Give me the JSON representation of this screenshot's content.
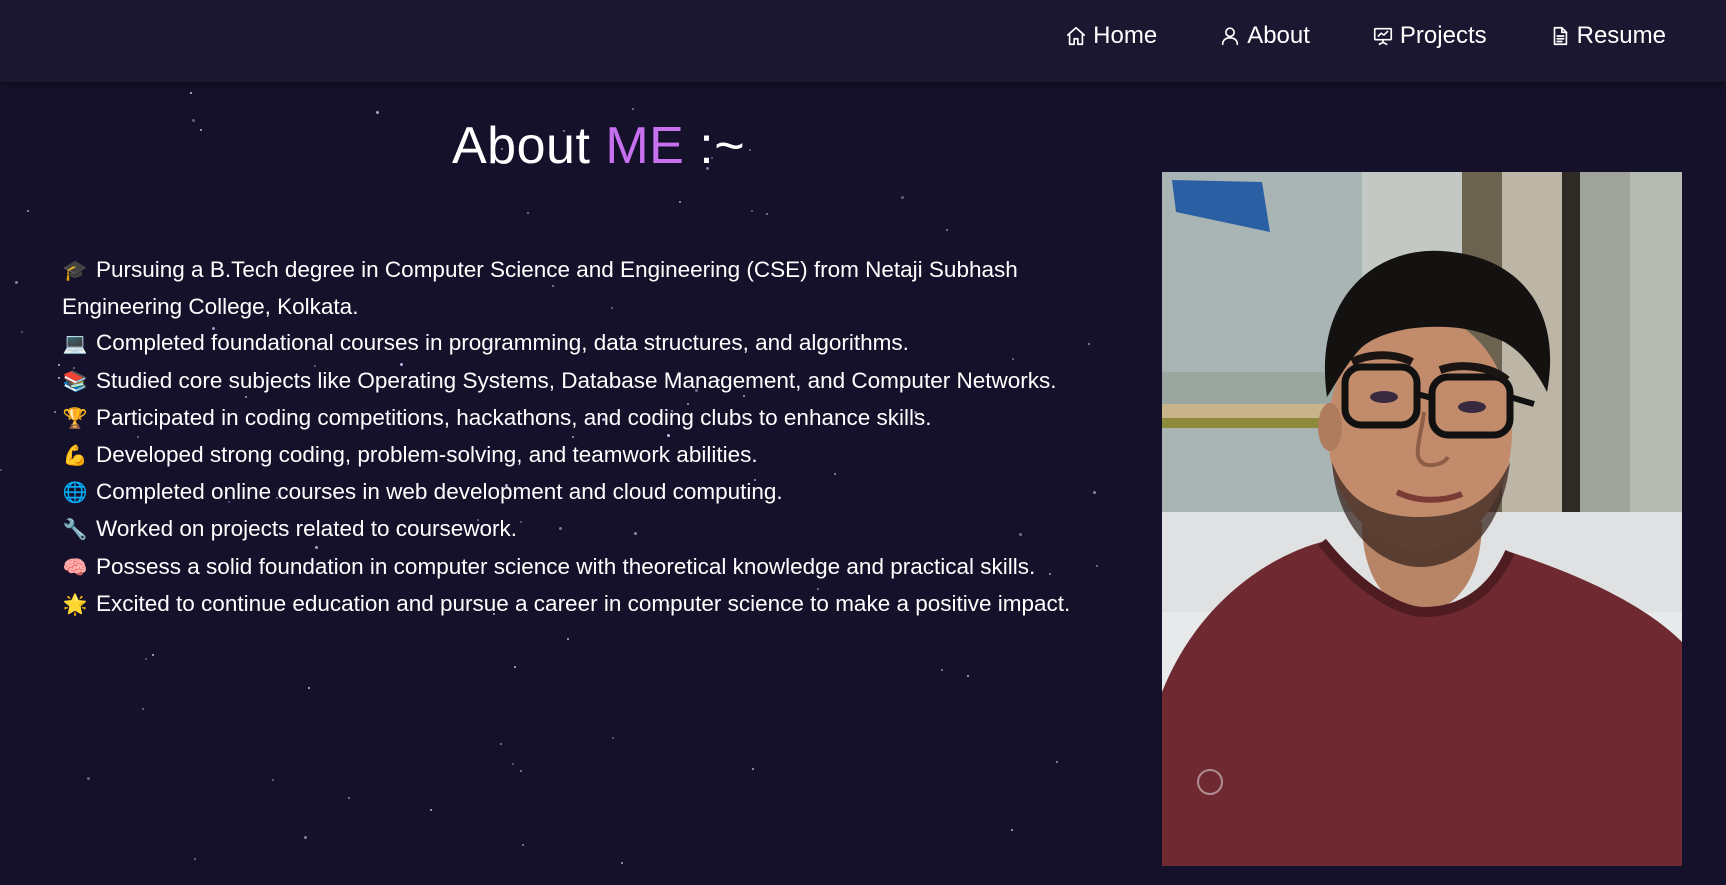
{
  "nav": {
    "items": [
      {
        "label": "Home",
        "icon": "home-icon"
      },
      {
        "label": "About",
        "icon": "user-icon"
      },
      {
        "label": "Projects",
        "icon": "presentation-icon"
      },
      {
        "label": "Resume",
        "icon": "document-icon"
      }
    ]
  },
  "about": {
    "title_prefix": "About",
    "title_accent": "ME",
    "title_suffix": ":~",
    "accent_color": "#c770f0",
    "points": [
      {
        "emoji": "🎓",
        "text": "Pursuing a B.Tech degree in Computer Science and Engineering (CSE) from Netaji Subhash Engineering College, Kolkata."
      },
      {
        "emoji": "💻",
        "text": "Completed foundational courses in programming, data structures, and algorithms."
      },
      {
        "emoji": "📚",
        "text": "Studied core subjects like Operating Systems, Database Management, and Computer Networks."
      },
      {
        "emoji": "🏆",
        "text": "Participated in coding competitions, hackathons, and coding clubs to enhance skills."
      },
      {
        "emoji": "💪",
        "text": "Developed strong coding, problem-solving, and teamwork abilities."
      },
      {
        "emoji": "🌐",
        "text": "Completed online courses in web development and cloud computing."
      },
      {
        "emoji": "🔧",
        "text": "Worked on projects related to coursework."
      },
      {
        "emoji": "🧠",
        "text": "Possess a solid foundation in computer science with theoretical knowledge and practical skills."
      },
      {
        "emoji": "🌟",
        "text": "Excited to continue education and pursue a career in computer science to make a positive impact."
      }
    ]
  },
  "colors": {
    "background": "#16112a",
    "navbar": "#1b1730",
    "accent": "#c770f0"
  }
}
